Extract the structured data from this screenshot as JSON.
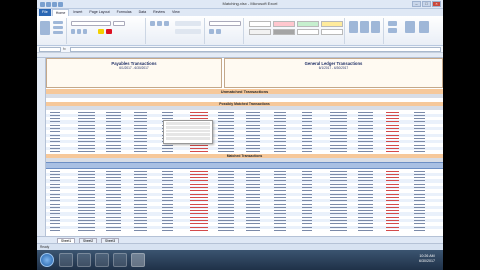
{
  "colors": {
    "accent": "#2a67b4",
    "section": "#f6c89a",
    "rowAlt": "#eaf1fb",
    "selection": "#a9c0e3"
  },
  "window": {
    "title": "Matching.xlsx - Microsoft Excel"
  },
  "ribbon_tabs": [
    "File",
    "Home",
    "Insert",
    "Page Layout",
    "Formulas",
    "Data",
    "Review",
    "View"
  ],
  "formula": {
    "fx": "fx"
  },
  "panels": {
    "left": {
      "title": "Payables Transactions",
      "date": "6/1/2017 - 6/30/2017"
    },
    "right": {
      "title": "General Ledger Transactions",
      "date": "6/1/2017 - 6/30/2017"
    }
  },
  "sections": {
    "unmatched": "Unmatched Transactions",
    "possibly": "Possibly Matched Transactions",
    "matched": "Matched Transactions"
  },
  "sheet_tabs": [
    "Sheet1",
    "Sheet2",
    "Sheet3"
  ],
  "status": {
    "ready": "Ready"
  },
  "clock": {
    "time": "10:26 AM",
    "date": "6/30/2017"
  }
}
